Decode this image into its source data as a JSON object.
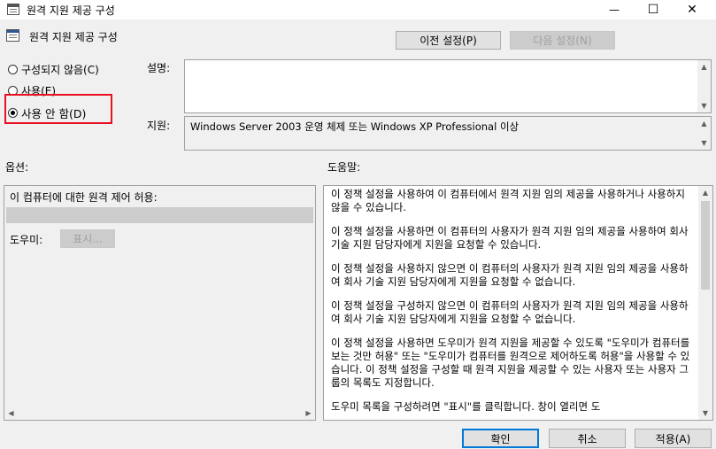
{
  "window": {
    "title": "원격 지원 제공 구성",
    "minimize": "—",
    "maximize": "☐",
    "close": "✕"
  },
  "header": {
    "policy_name": "원격 지원 제공 구성",
    "prev_button": "이전 설정(P)",
    "next_button": "다음 설정(N)"
  },
  "state": {
    "not_configured": "구성되지 않음(C)",
    "enabled": "사용(E)",
    "disabled": "사용 안 함(D)",
    "selected": "disabled"
  },
  "comment": {
    "label": "설명:"
  },
  "supported": {
    "label": "지원:",
    "value": "Windows Server 2003 운영 체제 또는 Windows XP Professional 이상"
  },
  "options": {
    "label": "옵션:",
    "permit_label": "이 컴퓨터에 대한 원격 제어 허용:",
    "helpers_label": "도우미:",
    "show_button": "표시..."
  },
  "help": {
    "label": "도움말:",
    "paragraphs": [
      "이 정책 설정을 사용하여 이 컴퓨터에서 원격 지원 임의 제공을 사용하거나 사용하지 않을 수 있습니다.",
      "이 정책 설정을 사용하면 이 컴퓨터의 사용자가 원격 지원 임의 제공을 사용하여 회사 기술 지원 담당자에게 지원을 요청할 수 있습니다.",
      "이 정책 설정을 사용하지 않으면 이 컴퓨터의 사용자가 원격 지원 임의 제공을 사용하여 회사 기술 지원 담당자에게 지원을 요청할 수 없습니다.",
      "이 정책 설정을 구성하지 않으면 이 컴퓨터의 사용자가 원격 지원 임의 제공을 사용하여 회사 기술 지원 담당자에게 지원을 요청할 수 없습니다.",
      "이 정책 설정을 사용하면 도우미가 원격 지원을 제공할 수 있도록 \"도우미가 컴퓨터를 보는 것만 허용\" 또는 \"도우미가 컴퓨터를 원격으로 제어하도록 허용\"을 사용할 수 있습니다. 이 정책 설정을 구성할 때 원격 지원을 제공할 수 있는 사용자 또는 사용자 그룹의 목록도 지정합니다.",
      "도우미 목록을 구성하려면 \"표시\"를 클릭합니다. 창이 열리면 도"
    ]
  },
  "footer": {
    "ok": "확인",
    "cancel": "취소",
    "apply": "적용(A)"
  },
  "colors": {
    "highlight_box": "#e81123",
    "accent": "#0078d7"
  }
}
